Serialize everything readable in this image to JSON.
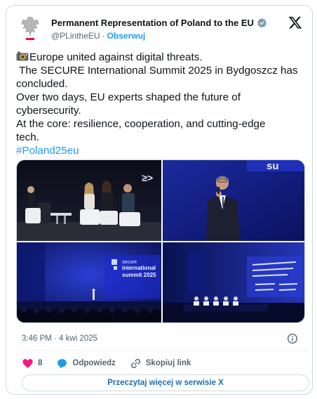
{
  "author": {
    "name": "Permanent Representation of Poland to the EU",
    "handle": "@PLintheEU",
    "separator": "·",
    "follow_label": "Obserwuj",
    "avatar_icon": "polish-eagle-emblem",
    "verified_icon": "verified-badge"
  },
  "tweet": {
    "lines": [
      "Europe united against digital threats.",
      " The SECURE International Summit 2025 in Bydgoszcz has",
      "concluded.",
      "Over two days, EU experts shaped the future of",
      "cybersecurity.",
      "At the core: resilience, cooperation, and cutting-edge",
      "tech."
    ],
    "hashtag": "#Poland25eu",
    "leading_emoji": "camera-emoji"
  },
  "media": {
    "photos": [
      "panel-discussion-photo",
      "speaker-at-podium-photo",
      "secure-summit-stage-photo",
      "cyber-blueprint-panel-photo"
    ],
    "stage_screen_text": [
      "secure",
      "international",
      "summit 2025"
    ],
    "banner_text": "su"
  },
  "meta": {
    "timestamp": "3:46 PM · 4 kwi 2025"
  },
  "actions": {
    "like_count": "8",
    "reply_label": "Odpowiedz",
    "copy_label": "Skopiuj link"
  },
  "footer": {
    "read_more_label": "Przeczytaj więcej w serwisie X"
  },
  "colors": {
    "accent": "#1d9bf0",
    "like": "#f91880",
    "text_secondary": "#536471",
    "border": "#cfd9de"
  }
}
